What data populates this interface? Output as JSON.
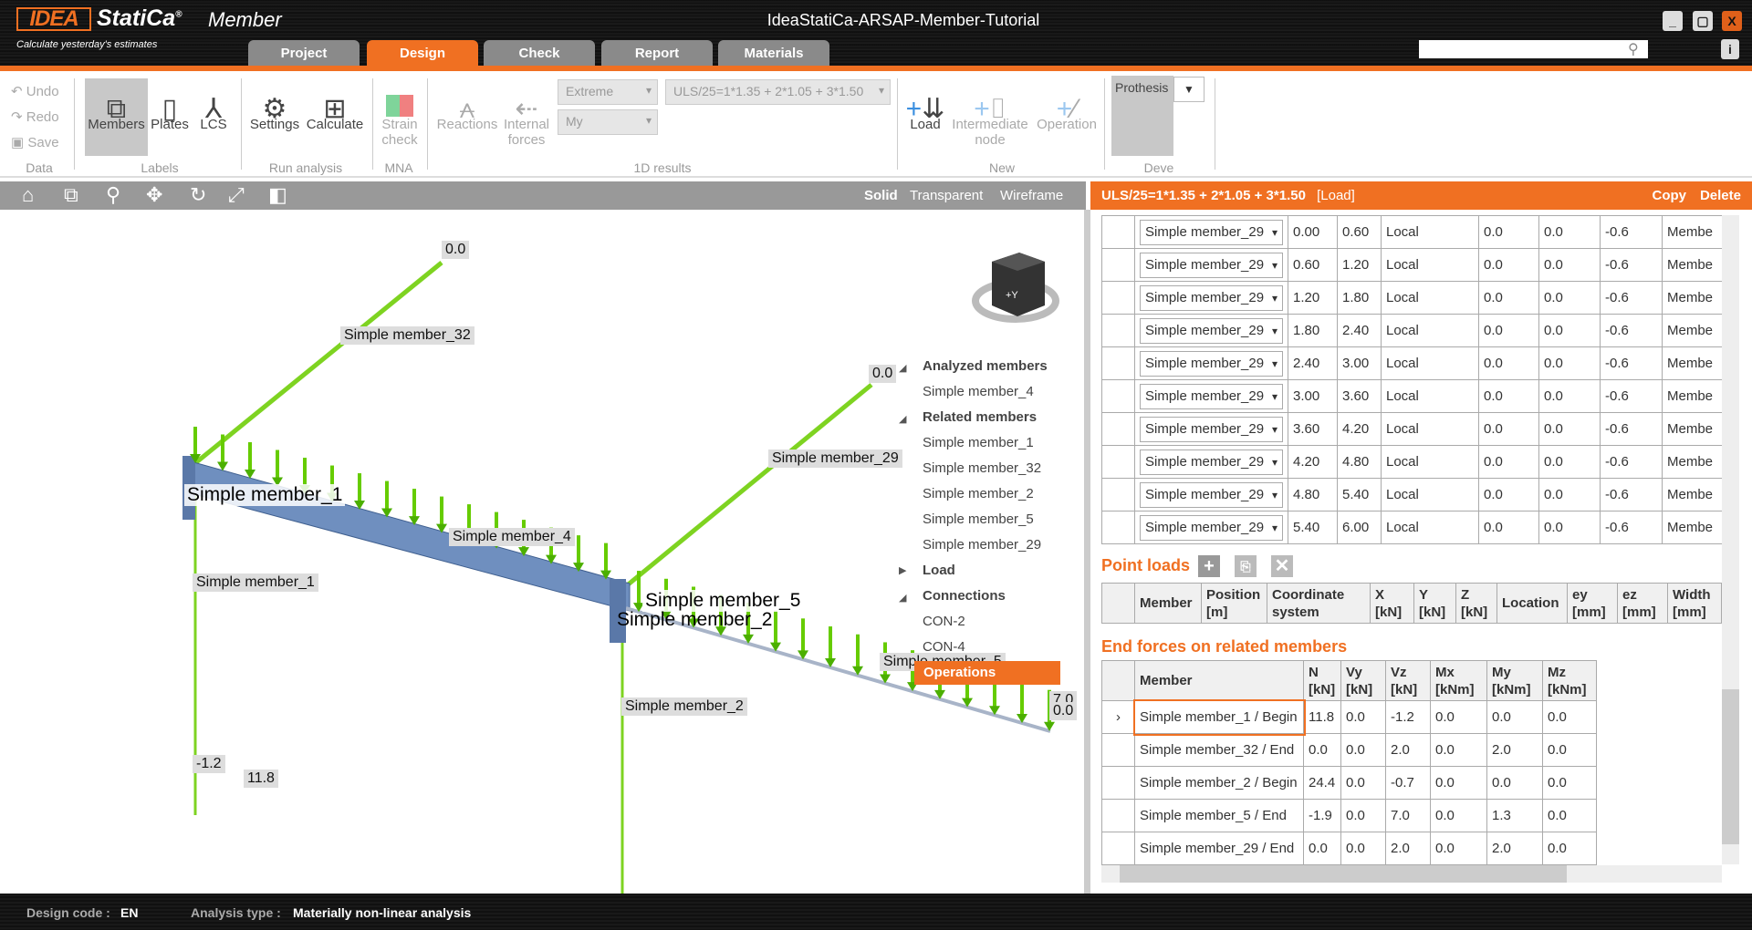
{
  "app": {
    "logo": "IDEA StatiCa",
    "product": "Member",
    "tagline": "Calculate yesterday's estimates",
    "title": "IdeaStatiCa-ARSAP-Member-Tutorial",
    "search_placeholder": ""
  },
  "tabs": [
    {
      "label": "Project"
    },
    {
      "label": "Design",
      "active": true
    },
    {
      "label": "Check"
    },
    {
      "label": "Report"
    },
    {
      "label": "Materials"
    }
  ],
  "ribbon": {
    "data": {
      "undo": "Undo",
      "redo": "Redo",
      "save": "Save",
      "group": "Data"
    },
    "labels": {
      "members": "Members",
      "plates": "Plates",
      "lcs": "LCS",
      "group": "Labels"
    },
    "run": {
      "settings": "Settings",
      "calculate": "Calculate",
      "group": "Run analysis"
    },
    "mna": {
      "strain1": "Strain",
      "strain2": "check",
      "group": "MNA"
    },
    "results": {
      "reactions": "Reactions",
      "internal1": "Internal",
      "internal2": "forces",
      "extreme": "Extreme",
      "my": "My",
      "combination": "ULS/25=1*1.35 + 2*1.05 + 3*1.50",
      "group": "1D results"
    },
    "new": {
      "load": "Load",
      "inter1": "Intermediate",
      "inter2": "node",
      "operation": "Operation",
      "group": "New"
    },
    "deve": {
      "prothesis": "Prothesis",
      "group": "Deve"
    }
  },
  "viewbar": {
    "modes": [
      "Solid",
      "Transparent",
      "Wireframe"
    ]
  },
  "right_header": {
    "combination": "ULS/25=1*1.35 + 2*1.05 + 3*1.50",
    "tag": "[Load]",
    "copy": "Copy",
    "delete": "Delete"
  },
  "line_loads": {
    "rows": [
      [
        "Simple member_29",
        "0.00",
        "0.60",
        "Local",
        "0.0",
        "0.0",
        "-0.6",
        "Membe"
      ],
      [
        "Simple member_29",
        "0.60",
        "1.20",
        "Local",
        "0.0",
        "0.0",
        "-0.6",
        "Membe"
      ],
      [
        "Simple member_29",
        "1.20",
        "1.80",
        "Local",
        "0.0",
        "0.0",
        "-0.6",
        "Membe"
      ],
      [
        "Simple member_29",
        "1.80",
        "2.40",
        "Local",
        "0.0",
        "0.0",
        "-0.6",
        "Membe"
      ],
      [
        "Simple member_29",
        "2.40",
        "3.00",
        "Local",
        "0.0",
        "0.0",
        "-0.6",
        "Membe"
      ],
      [
        "Simple member_29",
        "3.00",
        "3.60",
        "Local",
        "0.0",
        "0.0",
        "-0.6",
        "Membe"
      ],
      [
        "Simple member_29",
        "3.60",
        "4.20",
        "Local",
        "0.0",
        "0.0",
        "-0.6",
        "Membe"
      ],
      [
        "Simple member_29",
        "4.20",
        "4.80",
        "Local",
        "0.0",
        "0.0",
        "-0.6",
        "Membe"
      ],
      [
        "Simple member_29",
        "4.80",
        "5.40",
        "Local",
        "0.0",
        "0.0",
        "-0.6",
        "Membe"
      ],
      [
        "Simple member_29",
        "5.40",
        "6.00",
        "Local",
        "0.0",
        "0.0",
        "-0.6",
        "Membe"
      ]
    ]
  },
  "point_loads": {
    "title": "Point loads",
    "headers": [
      [
        "Member",
        ""
      ],
      [
        "Position",
        "[m]"
      ],
      [
        "Coordinate",
        "system"
      ],
      [
        "X",
        "[kN]"
      ],
      [
        "Y",
        "[kN]"
      ],
      [
        "Z",
        "[kN]"
      ],
      [
        "Location",
        ""
      ],
      [
        "ey",
        "[mm]"
      ],
      [
        "ez",
        "[mm]"
      ],
      [
        "Width",
        "[mm]"
      ]
    ]
  },
  "end_forces": {
    "title": "End forces on related members",
    "headers": [
      [
        "Member",
        ""
      ],
      [
        "N",
        "[kN]"
      ],
      [
        "Vy",
        "[kN]"
      ],
      [
        "Vz",
        "[kN]"
      ],
      [
        "Mx",
        "[kNm]"
      ],
      [
        "My",
        "[kNm]"
      ],
      [
        "Mz",
        "[kNm]"
      ]
    ],
    "rows": [
      [
        "Simple member_1 / Begin",
        "11.8",
        "0.0",
        "-1.2",
        "0.0",
        "0.0",
        "0.0"
      ],
      [
        "Simple member_32 / End",
        "0.0",
        "0.0",
        "2.0",
        "0.0",
        "2.0",
        "0.0"
      ],
      [
        "Simple member_2 / Begin",
        "24.4",
        "0.0",
        "-0.7",
        "0.0",
        "0.0",
        "0.0"
      ],
      [
        "Simple member_5 / End",
        "-1.9",
        "0.0",
        "7.0",
        "0.0",
        "1.3",
        "0.0"
      ],
      [
        "Simple member_29 / End",
        "0.0",
        "0.0",
        "2.0",
        "0.0",
        "2.0",
        "0.0"
      ]
    ]
  },
  "tree": {
    "analyzed": "Analyzed members",
    "analyzed_items": [
      "Simple member_4"
    ],
    "related": "Related members",
    "related_items": [
      "Simple member_1",
      "Simple member_32",
      "Simple member_2",
      "Simple member_5",
      "Simple member_29"
    ],
    "load": "Load",
    "connections": "Connections",
    "connection_items": [
      "CON-2",
      "CON-4"
    ],
    "operations": "Operations"
  },
  "viewport": {
    "labels": {
      "m32": "Simple member_32",
      "m29": "Simple member_29",
      "m1_big": "Simple member_1",
      "m4": "Simple member_4",
      "m1": "Simple member_1",
      "m5_big": "Simple member_5",
      "m2_big": "Simple member_2",
      "m2": "Simple member_2",
      "m5_partial": "Simple member_5"
    },
    "values": {
      "v_top32": "0.0",
      "v_top29": "0.0",
      "v_m1a": "-1.2",
      "v_m1b": "11.8",
      "v_end1": "7.0",
      "v_end2": "0.0"
    },
    "cube": {
      "face": "+Y"
    }
  },
  "status": {
    "code_label": "Design code :",
    "code": "EN",
    "analysis_label": "Analysis type :",
    "analysis": "Materially non-linear analysis"
  },
  "colors": {
    "accent": "#f07022",
    "load": "#66cc00",
    "member": "#6f8fbf"
  }
}
